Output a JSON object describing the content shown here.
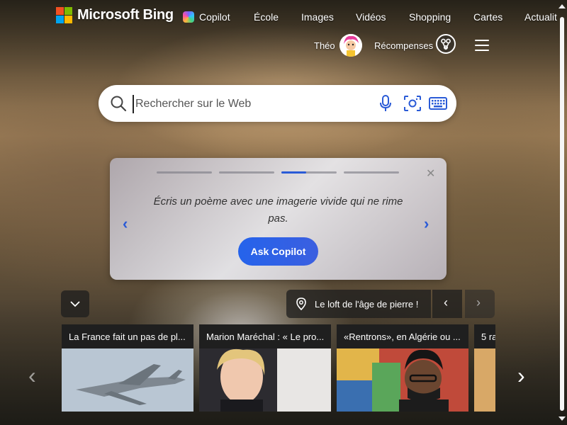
{
  "brand": {
    "name": "Microsoft Bing"
  },
  "nav": {
    "items": [
      {
        "label": "Copilot",
        "icon": "copilot-icon"
      },
      {
        "label": "École"
      },
      {
        "label": "Images"
      },
      {
        "label": "Vidéos"
      },
      {
        "label": "Shopping"
      },
      {
        "label": "Cartes"
      },
      {
        "label": "Actualit"
      }
    ]
  },
  "user": {
    "name": "Théo",
    "rewards_label": "Récompenses"
  },
  "search": {
    "placeholder": "Rechercher sur le Web",
    "value": ""
  },
  "copilot_card": {
    "prompt": "Écris un poème avec une imagerie vivide qui ne rime pas.",
    "button_label": "Ask Copilot",
    "close_glyph": "✕",
    "prev_glyph": "‹",
    "next_glyph": "›",
    "progress": [
      0,
      0,
      0.45,
      0
    ]
  },
  "location": {
    "label": "Le loft de l'âge de pierre !"
  },
  "news": [
    {
      "title": "La France fait un pas de pl..."
    },
    {
      "title": "Marion Maréchal : « Le pro..."
    },
    {
      "title": "«Rentrons», en Algérie ou ..."
    },
    {
      "title": "5 ra"
    }
  ],
  "glyphs": {
    "collapse": "⌄",
    "prev": "‹",
    "next": "›",
    "news_prev": "‹",
    "news_next": "›"
  },
  "colors": {
    "accent": "#2a5bd7",
    "button": "#2563eb"
  }
}
